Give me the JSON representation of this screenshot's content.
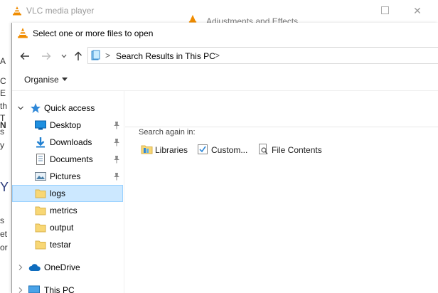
{
  "background_window": {
    "title": "VLC media player",
    "secondary_title": "Adjustments and Effects",
    "close_glyph": "✕",
    "edge_text": [
      "A",
      "C",
      "E",
      "th",
      "T",
      "s",
      "y",
      "Y",
      "s",
      "et",
      "or"
    ],
    "edge_bold_text": "N"
  },
  "dialog": {
    "title": "Select one or more files to open",
    "address": {
      "path_text": "Search Results in This PC",
      "separator": ">",
      "trailing_separator": ">"
    },
    "command_bar": {
      "organise_label": "Organise"
    },
    "nav_pane": {
      "items": [
        {
          "label": "Quick access",
          "icon": "star-icon",
          "expandable": true,
          "expanded": true
        },
        {
          "label": "Desktop",
          "icon": "desktop-icon",
          "pinned": true
        },
        {
          "label": "Downloads",
          "icon": "download-icon",
          "pinned": true
        },
        {
          "label": "Documents",
          "icon": "documents-icon",
          "pinned": true
        },
        {
          "label": "Pictures",
          "icon": "pictures-icon",
          "pinned": true
        },
        {
          "label": "logs",
          "icon": "folder-icon",
          "selected": true
        },
        {
          "label": "metrics",
          "icon": "folder-icon"
        },
        {
          "label": "output",
          "icon": "folder-icon"
        },
        {
          "label": "testar",
          "icon": "folder-icon"
        },
        {
          "label": "OneDrive",
          "icon": "cloud-icon",
          "expandable": true
        },
        {
          "label": "This PC",
          "icon": "computer-icon",
          "expandable": true
        }
      ]
    },
    "content": {
      "search_again_label": "Search again in:",
      "links": [
        {
          "label": "Libraries",
          "icon": "libraries-icon"
        },
        {
          "label": "Custom...",
          "icon": "custom-icon"
        },
        {
          "label": "File Contents",
          "icon": "file-contents-icon"
        }
      ]
    }
  },
  "colors": {
    "selection_bg": "#cce8ff",
    "selection_border": "#99d1ff",
    "folder_yellow": "#f8d775",
    "accent_blue": "#1e88e5",
    "vlc_orange": "#f08c00"
  }
}
